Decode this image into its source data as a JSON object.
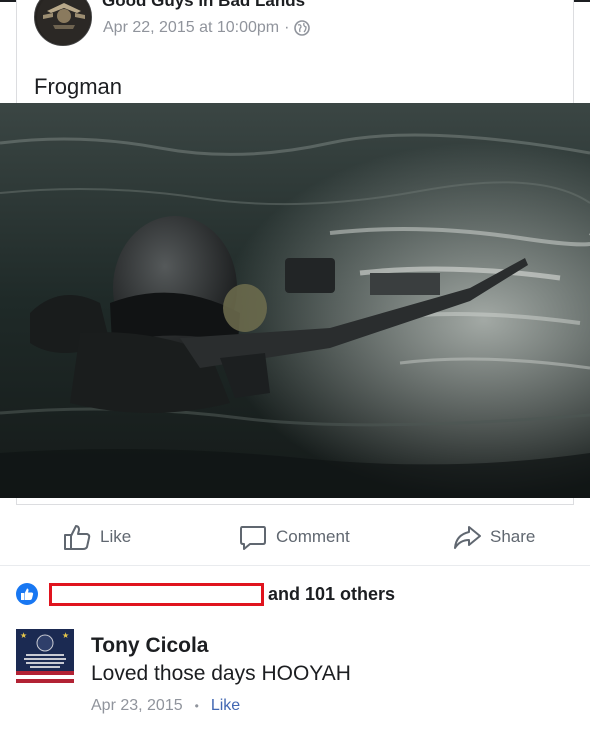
{
  "post": {
    "page_name": "Good Guys in Bad Lands",
    "timestamp": "Apr 22, 2015 at 10:00pm",
    "meta_dot": "·",
    "privacy_icon": "globe-icon",
    "text": "Frogman",
    "photo_icon": "photo"
  },
  "actions": {
    "like_label": "Like",
    "comment_label": "Comment",
    "share_label": "Share"
  },
  "reactions": {
    "summary": "and 101 others",
    "icon": "thumbs-up-icon",
    "redaction_color": "#e0141e"
  },
  "comment": {
    "author": "Tony Cicola",
    "text": "Loved those days HOOYAH",
    "date": "Apr 23, 2015",
    "separator": "•",
    "like_label": "Like"
  },
  "colors": {
    "accent": "#4267b2",
    "like_badge": "#1877f2",
    "meta_gray": "#90949c"
  }
}
